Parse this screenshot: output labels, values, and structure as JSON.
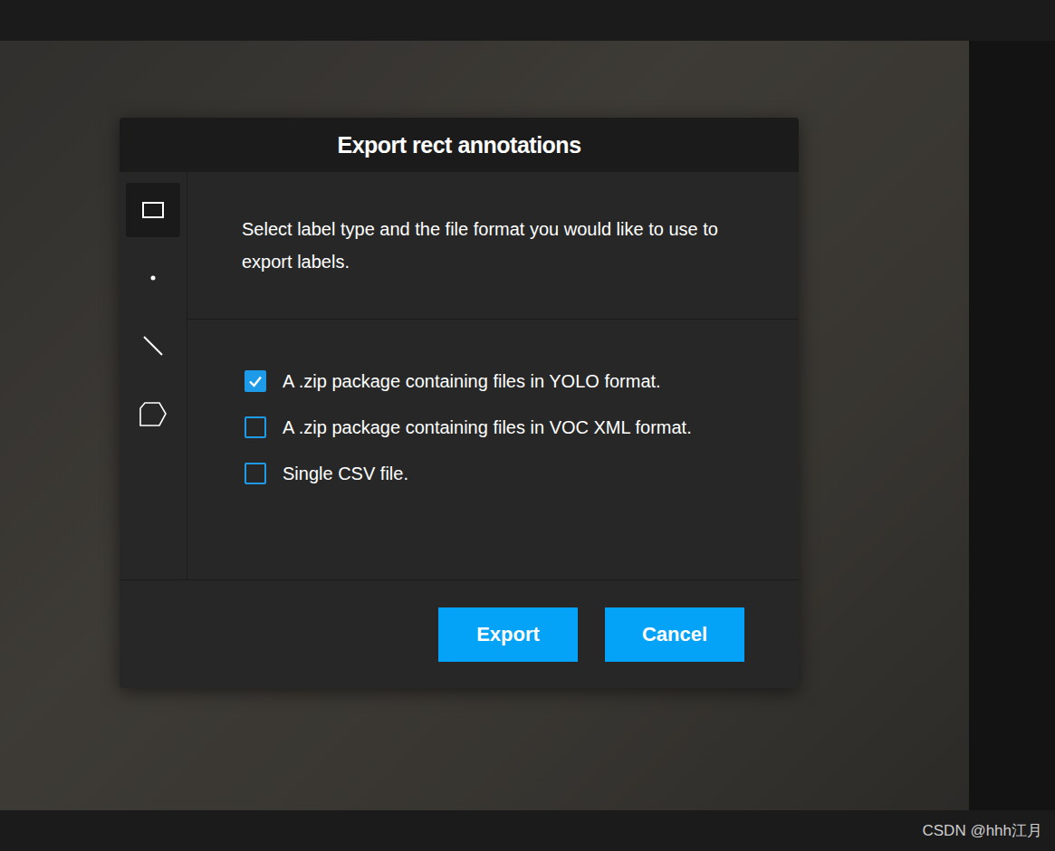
{
  "dialog": {
    "title": "Export rect annotations",
    "description": "Select label type and the file format you would like to use to export labels."
  },
  "label_types": [
    {
      "kind": "rect",
      "selected": true
    },
    {
      "kind": "point",
      "selected": false
    },
    {
      "kind": "line",
      "selected": false
    },
    {
      "kind": "polygon",
      "selected": false
    }
  ],
  "formats": [
    {
      "label": "A .zip package containing files in YOLO format.",
      "checked": true
    },
    {
      "label": "A .zip package containing files in VOC XML format.",
      "checked": false
    },
    {
      "label": "Single CSV file.",
      "checked": false
    }
  ],
  "buttons": [
    "Export",
    "Cancel"
  ],
  "watermark": "CSDN @hhh江月"
}
